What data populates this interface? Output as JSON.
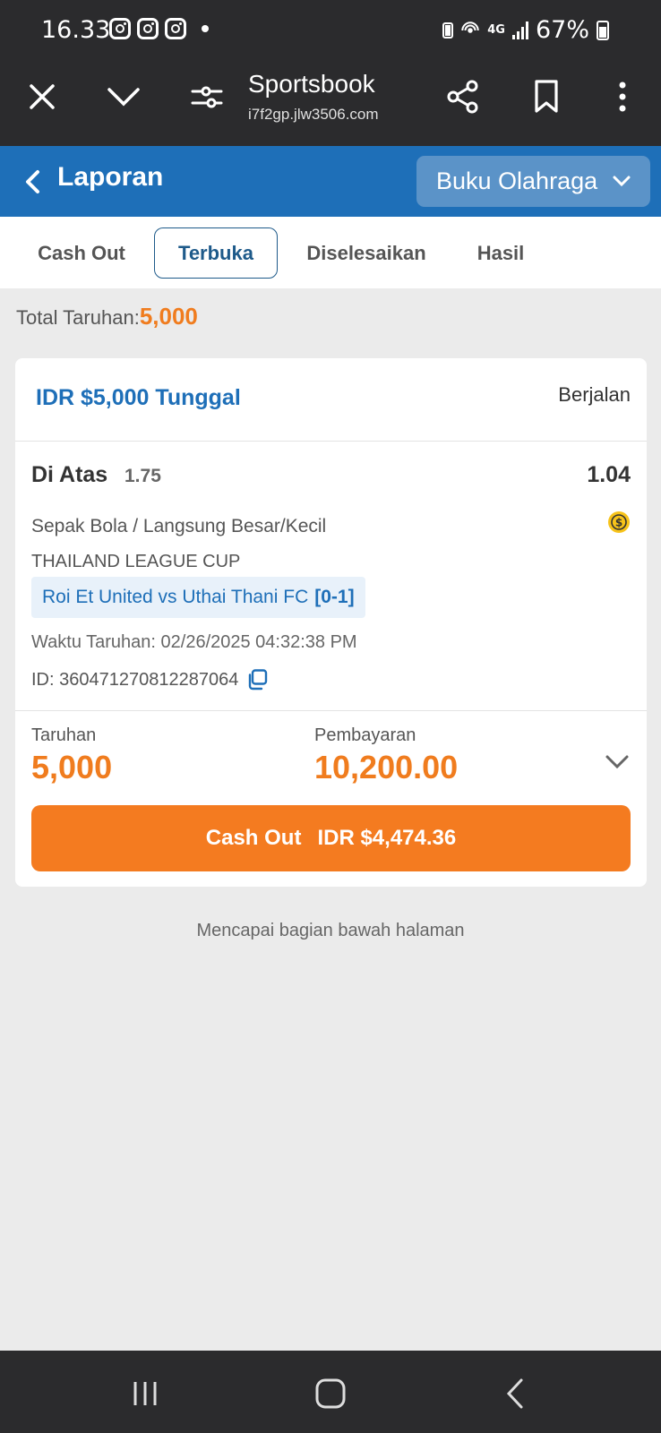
{
  "status_bar": {
    "time": "16.33",
    "network": "4G",
    "battery": "67%",
    "icons": [
      "instagram-icon",
      "instagram-icon",
      "instagram-icon",
      "notification-dot-icon",
      "battery-saver-icon",
      "hotspot-icon",
      "signal-icon",
      "battery-icon"
    ]
  },
  "browser": {
    "title": "Sportsbook",
    "url": "i7f2gp.jlw3506.com",
    "icons": [
      "close-icon",
      "chevron-down-icon",
      "tune-icon",
      "share-icon",
      "bookmark-icon",
      "more-vert-icon"
    ]
  },
  "header": {
    "title": "Laporan",
    "dropdown_label": "Buku Olahraga",
    "color": "#1e6fb8"
  },
  "tabs": [
    {
      "label": "Cash Out",
      "active": false
    },
    {
      "label": "Terbuka",
      "active": true
    },
    {
      "label": "Diselesaikan",
      "active": false
    },
    {
      "label": "Hasil",
      "active": false
    }
  ],
  "summary": {
    "total_label": "Total Taruhan:",
    "total_value": "5,000"
  },
  "bet": {
    "title": "IDR $5,000 Tunggal",
    "status": "Berjalan",
    "selection": "Di Atas",
    "line": "1.75",
    "odds": "1.04",
    "market": "Sepak Bola / Langsung Besar/Kecil",
    "league": "THAILAND LEAGUE CUP",
    "match": "Roi Et United vs Uthai Thani FC",
    "score": "[0-1]",
    "time_label": "Waktu Taruhan: 02/26/2025 04:32:38 PM",
    "id_label": "ID: 360471270812287064",
    "stake_label": "Taruhan",
    "stake_value": "5,000",
    "payout_label": "Pembayaran",
    "payout_value": "10,200.00",
    "cashout_label": "Cash Out",
    "cashout_value": "IDR $4,474.36",
    "accent_color": "#f47b20"
  },
  "footer_note": "Mencapai bagian bawah halaman",
  "nav": [
    "recent-apps-icon",
    "home-icon",
    "back-icon"
  ]
}
